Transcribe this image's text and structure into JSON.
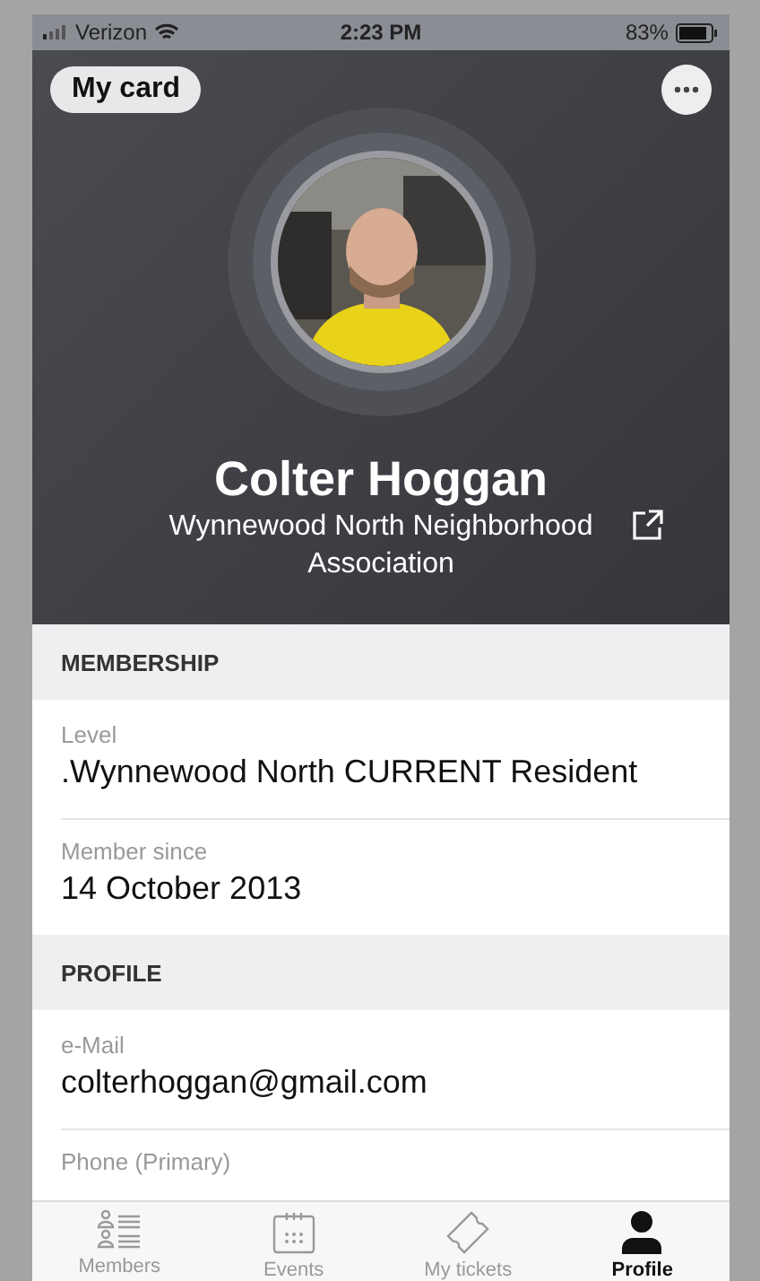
{
  "status_bar": {
    "carrier": "Verizon",
    "time": "2:23 PM",
    "battery": "83%"
  },
  "header": {
    "badge": "My card",
    "name": "Colter Hoggan",
    "organization": "Wynnewood North Neighborhood Association"
  },
  "sections": [
    {
      "title": "MEMBERSHIP",
      "fields": [
        {
          "label": "Level",
          "value": ".Wynnewood North CURRENT Resident"
        },
        {
          "label": "Member since",
          "value": "14 October 2013"
        }
      ]
    },
    {
      "title": "PROFILE",
      "fields": [
        {
          "label": "e-Mail",
          "value": "colterhoggan@gmail.com"
        },
        {
          "label": "Phone (Primary)"
        }
      ]
    }
  ],
  "tab_bar": [
    {
      "label": "Members",
      "kind": "members",
      "selected": false
    },
    {
      "label": "Events",
      "kind": "events",
      "selected": false
    },
    {
      "label": "My tickets",
      "kind": "tickets",
      "selected": false
    },
    {
      "label": "Profile",
      "kind": "profile",
      "selected": true
    }
  ]
}
